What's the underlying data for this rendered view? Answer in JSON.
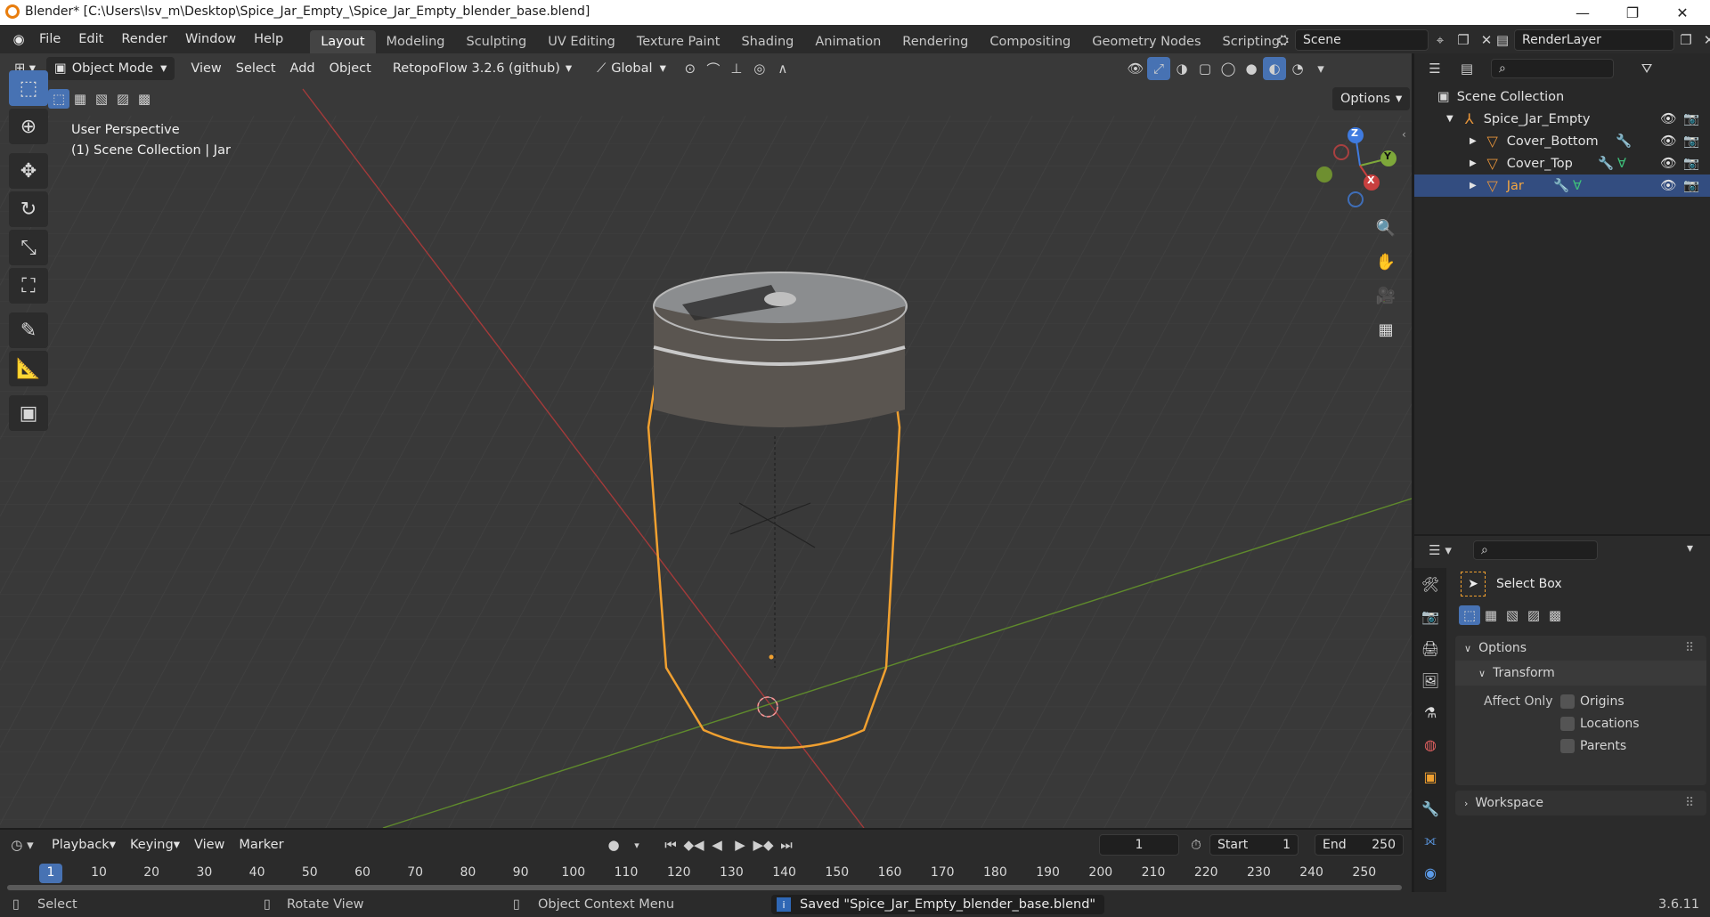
{
  "window": {
    "title": "Blender* [C:\\Users\\lsv_m\\Desktop\\Spice_Jar_Empty_\\Spice_Jar_Empty_blender_base.blend]"
  },
  "menus": [
    "File",
    "Edit",
    "Render",
    "Window",
    "Help"
  ],
  "workspaces": [
    "Layout",
    "Modeling",
    "Sculpting",
    "UV Editing",
    "Texture Paint",
    "Shading",
    "Animation",
    "Rendering",
    "Compositing",
    "Geometry Nodes",
    "Scripting"
  ],
  "scene": {
    "name": "Scene",
    "render_layer": "RenderLayer"
  },
  "viewport": {
    "mode": "Object Mode",
    "menus": [
      "View",
      "Select",
      "Add",
      "Object"
    ],
    "addon": "RetopoFlow 3.2.6 (github)",
    "orientation": "Global",
    "options_label": "Options",
    "perspective_label": "User Perspective",
    "collection_label": "(1) Scene Collection | Jar",
    "gizmo": {
      "z": "Z",
      "y": "Y",
      "x": "X"
    }
  },
  "outliner": {
    "root": "Scene Collection",
    "items": [
      {
        "name": "Spice_Jar_Empty"
      },
      {
        "name": "Cover_Bottom"
      },
      {
        "name": "Cover_Top"
      },
      {
        "name": "Jar"
      }
    ]
  },
  "properties": {
    "tool_name": "Select Box",
    "options_label": "Options",
    "transform_label": "Transform",
    "affect_only_label": "Affect Only",
    "checkboxes": [
      "Origins",
      "Locations",
      "Parents"
    ],
    "workspace_label": "Workspace"
  },
  "timeline": {
    "menus": [
      "Playback",
      "Keying",
      "View",
      "Marker"
    ],
    "current_frame": "1",
    "start_label": "Start",
    "start": "1",
    "end_label": "End",
    "end": "250",
    "ticks": [
      "1",
      "10",
      "20",
      "30",
      "40",
      "50",
      "60",
      "70",
      "80",
      "90",
      "100",
      "110",
      "120",
      "130",
      "140",
      "150",
      "160",
      "170",
      "180",
      "190",
      "200",
      "210",
      "220",
      "230",
      "240",
      "250"
    ]
  },
  "statusbar": {
    "select": "Select",
    "rotate": "Rotate View",
    "context": "Object Context Menu",
    "message": "Saved \"Spice_Jar_Empty_blender_base.blend\"",
    "version": "3.6.11"
  },
  "colors": {
    "accent": "#4772b3",
    "selection_outline": "#f0a030",
    "x_axis": "#c8403f",
    "y_axis": "#7ea83a",
    "z_axis": "#3f7be0"
  }
}
